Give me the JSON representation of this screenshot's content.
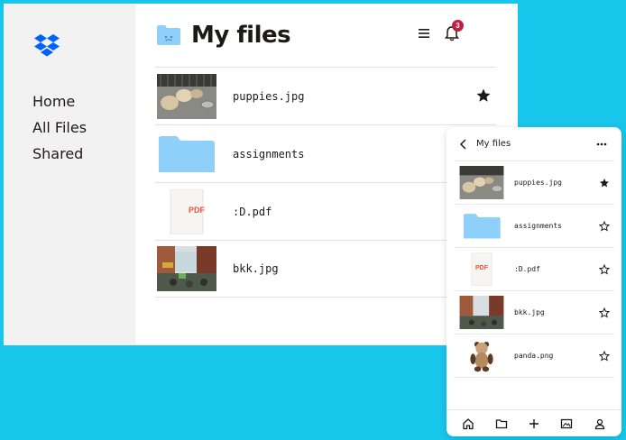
{
  "colors": {
    "background": "#17c6ea",
    "dropbox_blue": "#0061fe",
    "folder_blue": "#8fd0fb",
    "pdf_red": "#e8543a",
    "badge_red": "#c0203f"
  },
  "sidebar": {
    "logo_icon": "dropbox-icon",
    "items": [
      {
        "label": "Home"
      },
      {
        "label": "All Files"
      },
      {
        "label": "Shared"
      }
    ]
  },
  "header": {
    "title": "My files",
    "menu_icon": "menu-icon",
    "notification_icon": "bell-icon",
    "notification_count": "3"
  },
  "files": [
    {
      "name": "puppies.jpg",
      "type": "image",
      "thumb": "puppies-thumbnail",
      "starred": true
    },
    {
      "name": "assignments",
      "type": "folder",
      "thumb": "folder-icon",
      "starred": false
    },
    {
      "name": ":D.pdf",
      "type": "pdf",
      "thumb": "pdf-icon",
      "thumb_label": "PDF",
      "starred": false
    },
    {
      "name": "bkk.jpg",
      "type": "image",
      "thumb": "street-thumbnail",
      "starred": false
    }
  ],
  "mobile": {
    "title": "My files",
    "files": [
      {
        "name": "puppies.jpg",
        "type": "image",
        "starred": true
      },
      {
        "name": "assignments",
        "type": "folder",
        "starred": false
      },
      {
        "name": ":D.pdf",
        "type": "pdf",
        "thumb_label": "PDF",
        "starred": false
      },
      {
        "name": "bkk.jpg",
        "type": "image",
        "starred": false
      },
      {
        "name": "panda.png",
        "type": "image",
        "starred": false
      }
    ],
    "bottom_tabs": [
      "home-icon",
      "folder-icon",
      "plus-icon",
      "photos-icon",
      "account-icon"
    ]
  }
}
